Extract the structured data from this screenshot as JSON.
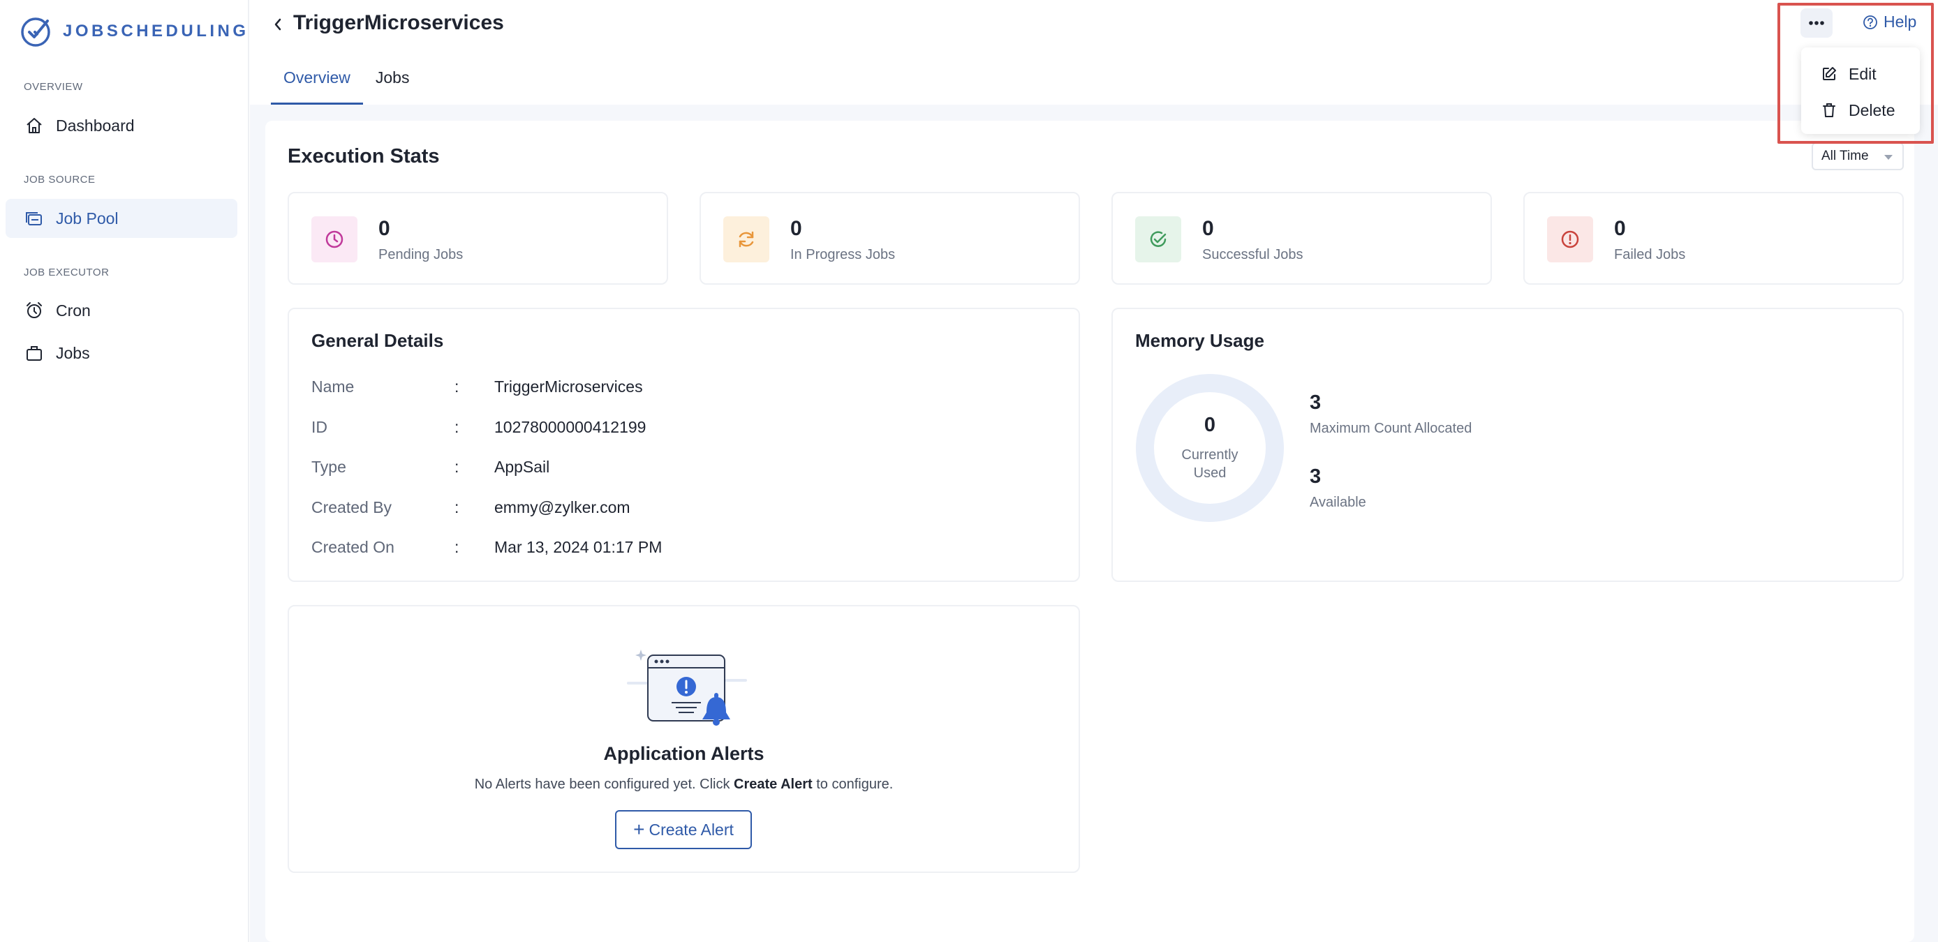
{
  "brand": {
    "name": "JOBSCHEDULING"
  },
  "sidebar": {
    "sections": [
      {
        "label": "OVERVIEW"
      },
      {
        "label": "JOB SOURCE"
      },
      {
        "label": "JOB EXECUTOR"
      }
    ],
    "items": [
      {
        "label": "Dashboard",
        "icon": "home-icon"
      },
      {
        "label": "Job Pool",
        "icon": "job-pool-icon",
        "active": true
      },
      {
        "label": "Cron",
        "icon": "alarm-clock-icon"
      },
      {
        "label": "Jobs",
        "icon": "briefcase-icon"
      }
    ]
  },
  "header": {
    "title": "TriggerMicroservices",
    "help_label": "Help",
    "tabs": [
      {
        "label": "Overview",
        "active": true
      },
      {
        "label": "Jobs",
        "active": false
      }
    ]
  },
  "menu": {
    "items": [
      {
        "label": "Edit",
        "icon": "edit-icon"
      },
      {
        "label": "Delete",
        "icon": "trash-icon"
      }
    ]
  },
  "execution_stats": {
    "title": "Execution Stats",
    "filter": "All Time",
    "stats": [
      {
        "value": "0",
        "label": "Pending Jobs",
        "icon": "clock-icon",
        "color": "#c0399a",
        "bg": "#fbe9f5"
      },
      {
        "value": "0",
        "label": "In Progress Jobs",
        "icon": "refresh-icon",
        "color": "#e8963a",
        "bg": "#fdf0dc"
      },
      {
        "value": "0",
        "label": "Successful Jobs",
        "icon": "check-circle-icon",
        "color": "#3f9b5c",
        "bg": "#e6f4ea"
      },
      {
        "value": "0",
        "label": "Failed Jobs",
        "icon": "alert-circle-icon",
        "color": "#c9433c",
        "bg": "#fbe7e6"
      }
    ]
  },
  "general_details": {
    "title": "General Details",
    "rows": [
      {
        "key": "Name",
        "value": "TriggerMicroservices"
      },
      {
        "key": "ID",
        "value": "10278000000412199"
      },
      {
        "key": "Type",
        "value": "AppSail"
      },
      {
        "key": "Created By",
        "value": "emmy@zylker.com"
      },
      {
        "key": "Created On",
        "value": "Mar 13, 2024 01:17 PM"
      }
    ]
  },
  "memory_usage": {
    "title": "Memory Usage",
    "current_value": "0",
    "current_label_line1": "Currently",
    "current_label_line2": "Used",
    "max_value": "3",
    "max_label": "Maximum Count Allocated",
    "available_value": "3",
    "available_label": "Available"
  },
  "alerts": {
    "title": "Application Alerts",
    "desc_before": "No Alerts have been configured yet. Click ",
    "desc_bold": "Create Alert",
    "desc_after": " to configure.",
    "button_label": "Create Alert"
  },
  "colors": {
    "accent": "#2f5aa8",
    "highlight_border": "#d9534f"
  }
}
